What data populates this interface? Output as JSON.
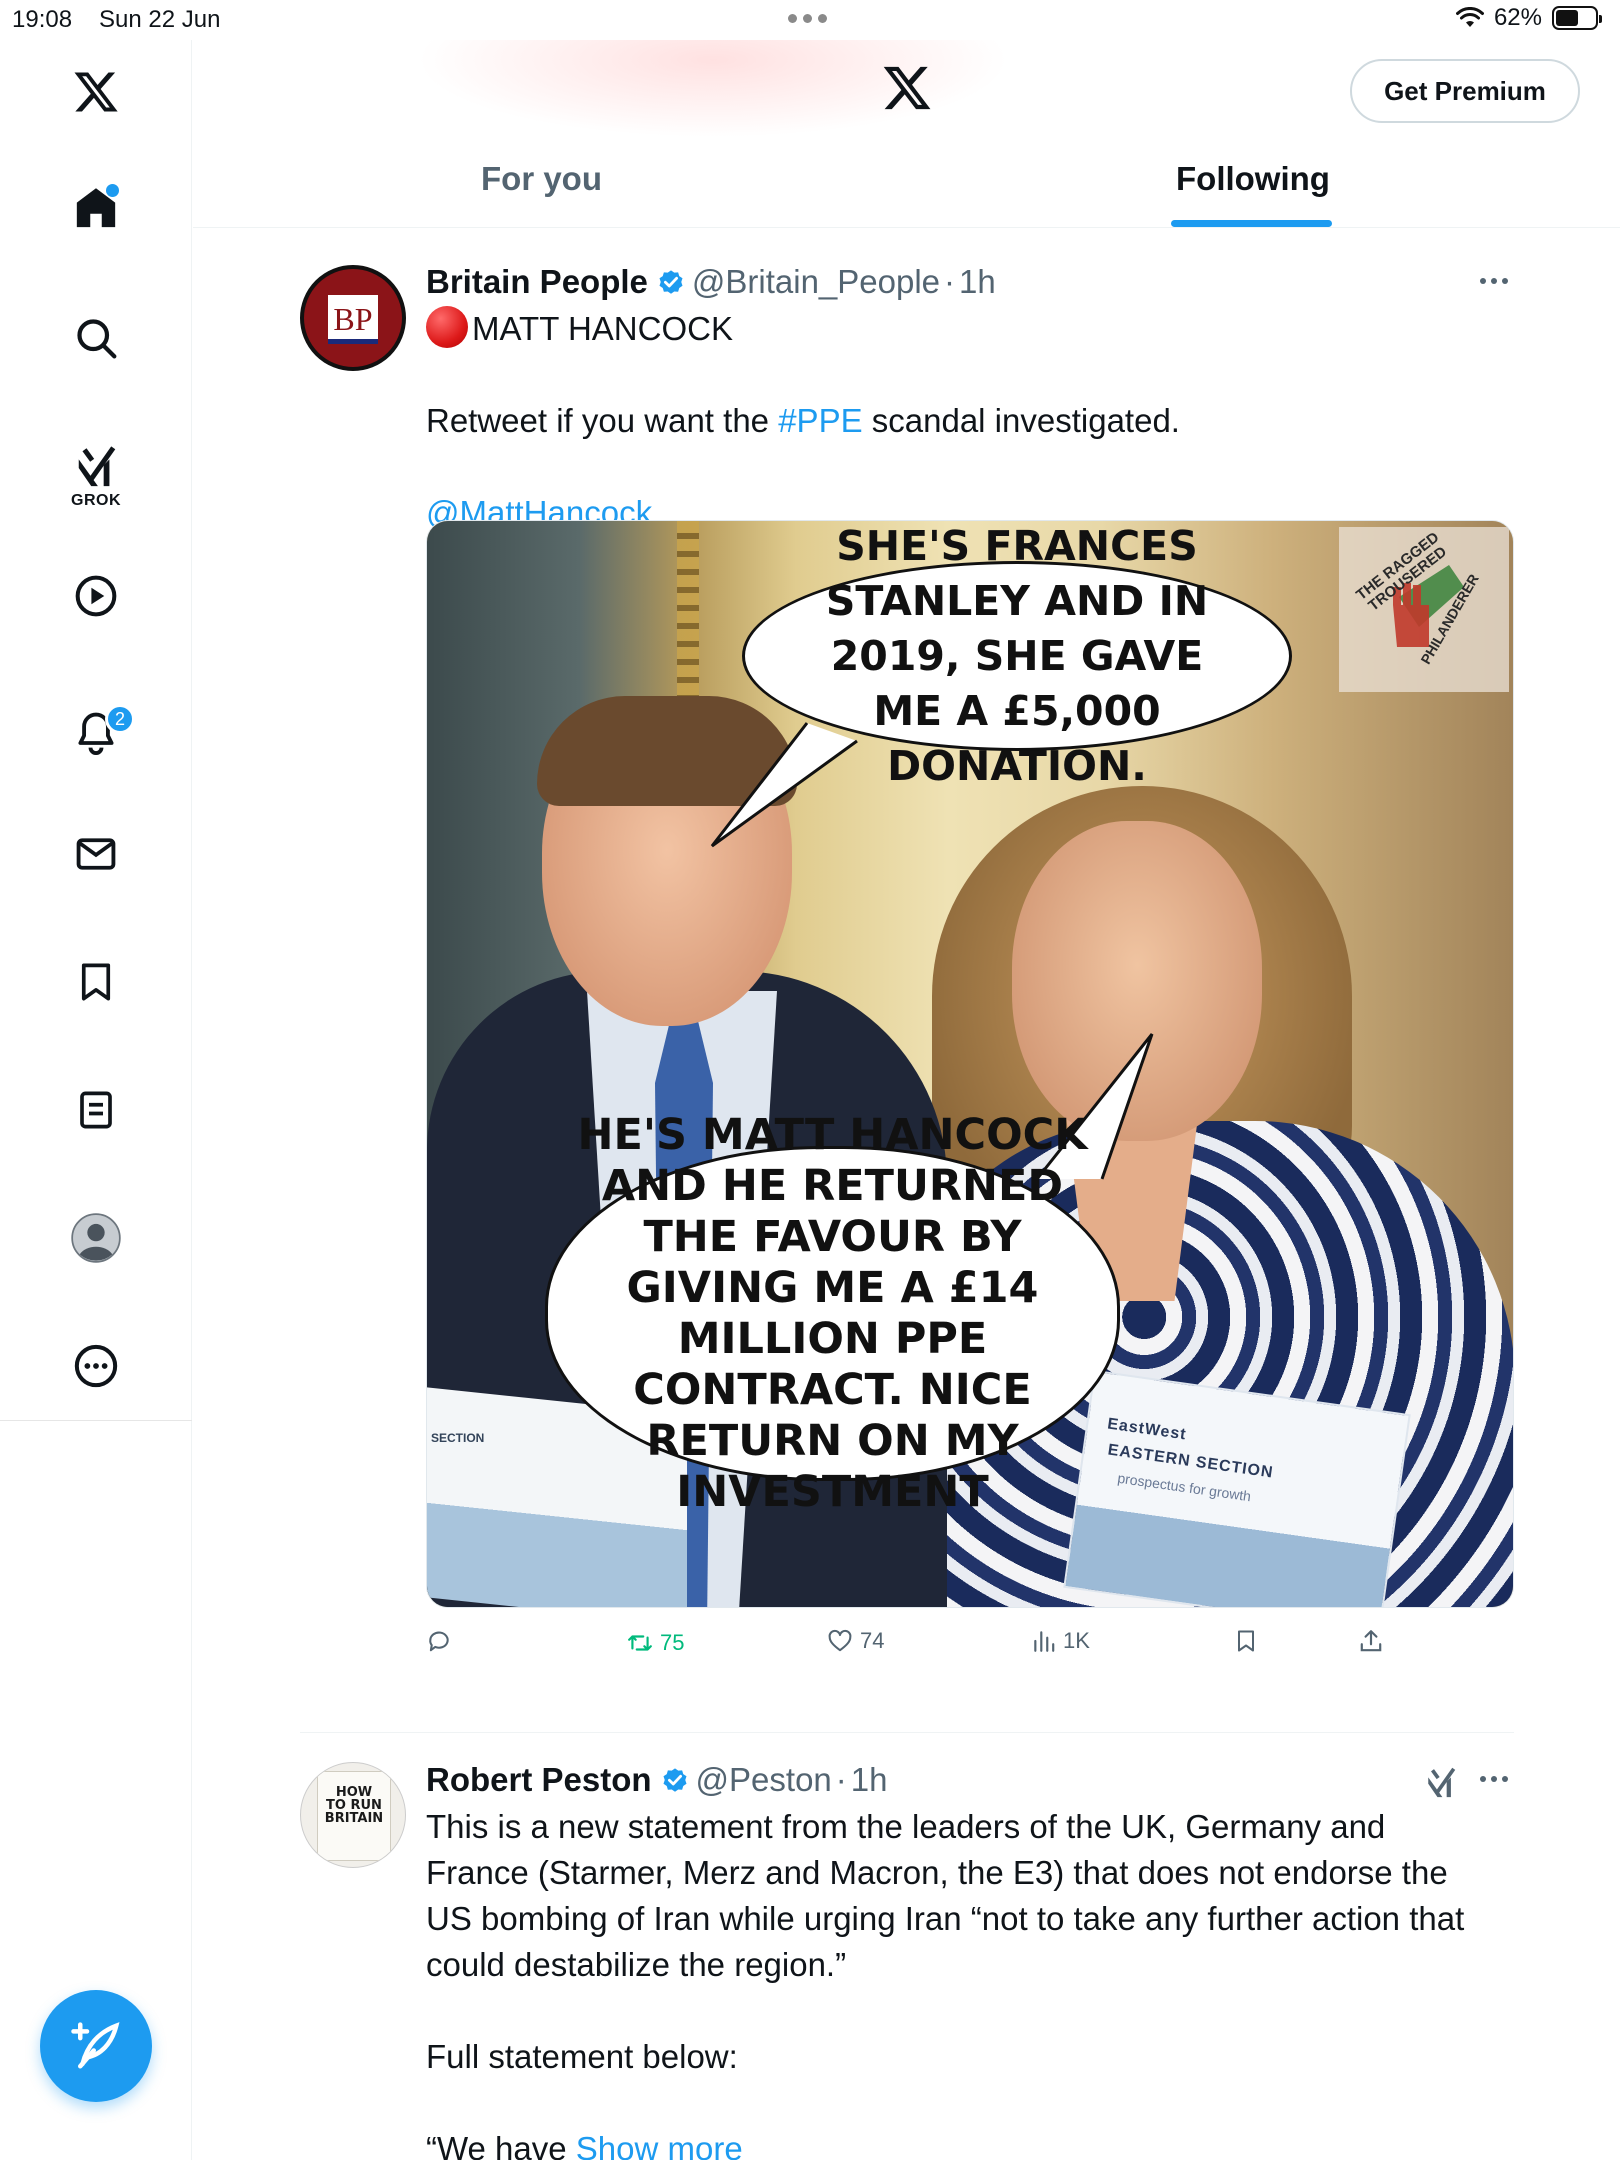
{
  "status_bar": {
    "time": "19:08",
    "date": "Sun 22 Jun",
    "battery": "62%",
    "battery_level": 0.62
  },
  "sidebar": {
    "grok_label": "GROK",
    "notifications_badge": "2",
    "items": [
      "x-logo",
      "home-icon",
      "search-icon",
      "grok-icon",
      "video-icon",
      "bell-icon",
      "mail-icon",
      "bookmark-icon",
      "lists-icon",
      "profile-icon",
      "more-icon"
    ]
  },
  "header": {
    "premium_label": "Get Premium",
    "tabs": [
      {
        "label": "For you"
      },
      {
        "label": "Following",
        "active": true
      }
    ]
  },
  "tweets": [
    {
      "name": "Britain People",
      "handle": "@Britain_People",
      "sep": "·",
      "time": "1h",
      "avatar_text": "BP",
      "line1": "MATT HANCOCK",
      "line2_pre": "Retweet if you want the ",
      "line2_tag": "#PPE",
      "line2_post": " scandal investigated.",
      "mention": "@MattHancock",
      "media": {
        "bubble1": "SHE'S FRANCES STANLEY AND IN 2019, SHE GAVE ME A £5,000 DONATION.",
        "bubble2": "HE'S MATT HANCOCK AND HE RETURNED THE FAVOUR BY GIVING ME A £14 MILLION PPE CONTRACT. NICE RETURN ON MY INVESTMENT",
        "watermark_top": "THE RAGGED TROUSERED",
        "watermark_bottom": "PHILANDERER",
        "brochure_left": "SECTION",
        "brochure_right_brand": "EastWest",
        "brochure_right_title": "EASTERN SECTION",
        "brochure_right_sub": "prospectus for growth"
      },
      "stats": {
        "retweets": "75",
        "likes": "74",
        "views": "1K"
      }
    },
    {
      "name": "Robert Peston",
      "handle": "@Peston",
      "sep": "·",
      "time": "1h",
      "avatar_book": "HOW TO RUN BRITAIN",
      "text_lines": [
        "This is a new statement from the leaders of the UK, Germany and",
        "France (Starmer, Merz and Macron, the E3) that does not endorse the",
        "US bombing of Iran while urging Iran “not to take any further action that",
        "could destabilize the region.”"
      ],
      "text_2": "Full statement below:",
      "text_3_pre": "“We have ",
      "show_more": "Show more"
    }
  ],
  "colors": {
    "accent": "#1d9bf0",
    "retweet_green": "#00ba7c",
    "secondary_text": "#536471"
  }
}
